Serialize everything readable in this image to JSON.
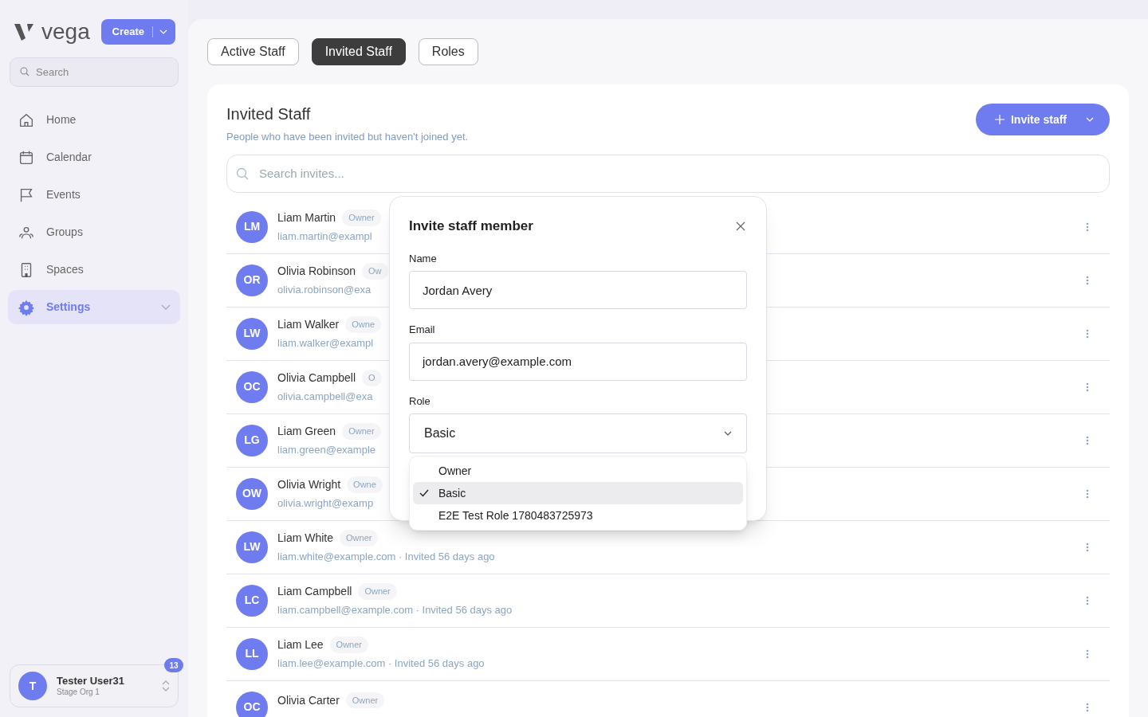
{
  "sidebar": {
    "logo": "vega",
    "create_button": "Create",
    "search": {
      "placeholder": "Search"
    },
    "items": [
      {
        "label": "Home",
        "selected": false
      },
      {
        "label": "Calendar",
        "selected": false
      },
      {
        "label": "Events",
        "selected": false
      },
      {
        "label": "Groups",
        "selected": false
      },
      {
        "label": "Spaces",
        "selected": false
      },
      {
        "label": "Settings",
        "selected": true
      }
    ],
    "user": {
      "initial": "T",
      "name": "Tester User31",
      "org": "Stage Org 1",
      "badge": "13"
    }
  },
  "tabs": [
    {
      "label": "Active Staff",
      "selected": false
    },
    {
      "label": "Invited Staff",
      "selected": true
    },
    {
      "label": "Roles",
      "selected": false
    }
  ],
  "panel": {
    "title": "Invited Staff",
    "subtitle": "People who have been invited but haven't joined yet.",
    "invite_button": "Invite staff",
    "search": {
      "placeholder": "Search invites..."
    }
  },
  "rows": [
    {
      "initials": "LM",
      "name": "Liam Martin",
      "role": "Owner",
      "detail": "liam.martin@exampl"
    },
    {
      "initials": "OR",
      "name": "Olivia Robinson",
      "role": "Ow",
      "detail": "olivia.robinson@exa"
    },
    {
      "initials": "LW",
      "name": "Liam Walker",
      "role": "Owne",
      "detail": "liam.walker@exampl"
    },
    {
      "initials": "OC",
      "name": "Olivia Campbell",
      "role": "O",
      "detail": "olivia.campbell@exa"
    },
    {
      "initials": "LG",
      "name": "Liam Green",
      "role": "Owner",
      "detail": "liam.green@example"
    },
    {
      "initials": "OW",
      "name": "Olivia Wright",
      "role": "Owne",
      "detail": "olivia.wright@examp"
    },
    {
      "initials": "LW",
      "name": "Liam White",
      "role": "Owner",
      "detail": "liam.white@example.com · Invited 56 days ago"
    },
    {
      "initials": "LC",
      "name": "Liam Campbell",
      "role": "Owner",
      "detail": "liam.campbell@example.com · Invited 56 days ago"
    },
    {
      "initials": "LL",
      "name": "Liam Lee",
      "role": "Owner",
      "detail": "liam.lee@example.com · Invited 56 days ago"
    },
    {
      "initials": "OC",
      "name": "Olivia Carter",
      "role": "Owner"
    }
  ],
  "dialog": {
    "title": "Invite staff member",
    "name_label": "Name",
    "name_value": "Jordan Avery",
    "email_label": "Email",
    "email_value": "jordan.avery@example.com",
    "role_label": "Role",
    "role_value": "Basic",
    "role_options": [
      {
        "label": "Owner",
        "selected": false
      },
      {
        "label": "Basic",
        "selected": true
      },
      {
        "label": "E2E Test Role 1780483725973",
        "selected": false
      }
    ]
  }
}
